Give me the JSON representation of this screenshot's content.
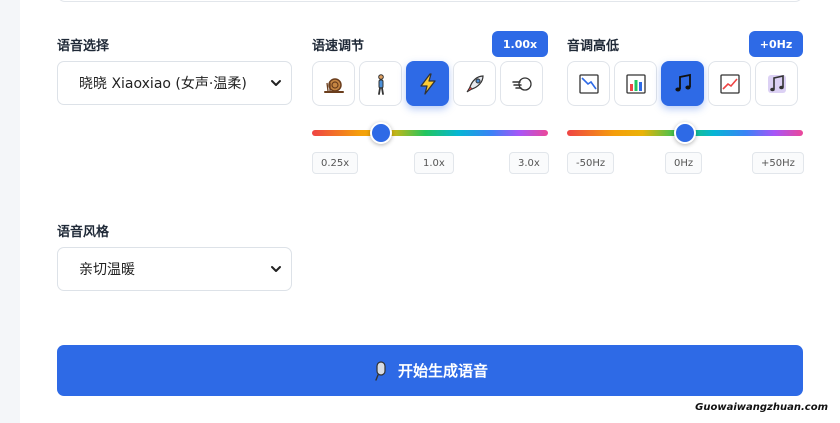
{
  "voice": {
    "label": "语音选择",
    "selected": "晓晓 Xiaoxiao (女声·温柔)"
  },
  "speed": {
    "label": "语速调节",
    "value_badge": "1.00x",
    "value": 1.0,
    "min_label": "0.25x",
    "mid_label": "1.0x",
    "max_label": "3.0x",
    "presets": [
      {
        "icon": "snail-icon",
        "active": false
      },
      {
        "icon": "walking-person-icon",
        "active": false
      },
      {
        "icon": "lightning-icon",
        "active": true
      },
      {
        "icon": "rocket-icon",
        "active": false
      },
      {
        "icon": "wind-icon",
        "active": false
      }
    ]
  },
  "pitch": {
    "label": "音调高低",
    "value_badge": "+0Hz",
    "value": 0,
    "min_label": "-50Hz",
    "mid_label": "0Hz",
    "max_label": "+50Hz",
    "presets": [
      {
        "icon": "chart-down-icon",
        "active": false
      },
      {
        "icon": "bar-chart-icon",
        "active": false
      },
      {
        "icon": "music-note-icon",
        "active": true
      },
      {
        "icon": "chart-up-icon",
        "active": false
      },
      {
        "icon": "music-notes-icon",
        "active": false
      }
    ]
  },
  "style": {
    "label": "语音风格",
    "selected": "亲切温暖"
  },
  "generate": {
    "label": "开始生成语音",
    "icon": "microphone-icon"
  },
  "watermark": "Guowaiwangzhuan.com",
  "colors": {
    "primary": "#2e6ae6",
    "border": "#e0e4ea"
  }
}
